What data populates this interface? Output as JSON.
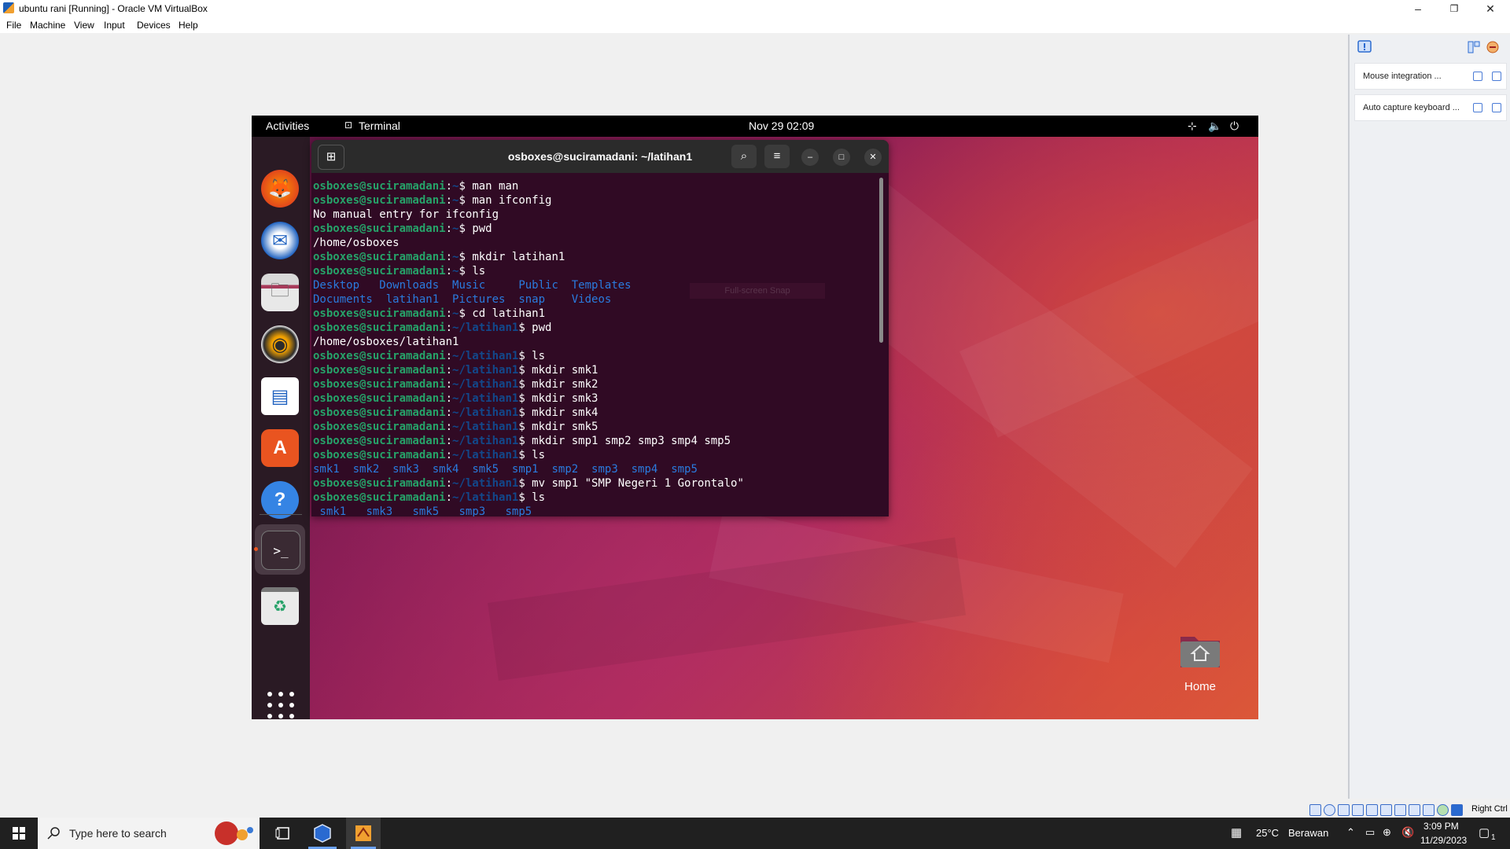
{
  "window": {
    "title": "ubuntu rani [Running] - Oracle VM VirtualBox",
    "controls": {
      "minimize": "–",
      "restore": "❐",
      "close": "✕"
    }
  },
  "menubar": [
    "File",
    "Machine",
    "View",
    "Input",
    "Devices",
    "Help"
  ],
  "vbox_panel": {
    "entries": [
      {
        "label": "Mouse integration ..."
      },
      {
        "label": "Auto capture keyboard ..."
      }
    ]
  },
  "guest": {
    "topbar": {
      "activities": "Activities",
      "app_label": "Terminal",
      "clock": "Nov 29  02:09"
    },
    "dock": {
      "apps": [
        {
          "name": "firefox",
          "glyph": "🦊"
        },
        {
          "name": "thunderbird",
          "glyph": "✉"
        },
        {
          "name": "files",
          "glyph": "🗀"
        },
        {
          "name": "rhythmbox",
          "glyph": "◉"
        },
        {
          "name": "writer",
          "glyph": "▤"
        },
        {
          "name": "software",
          "glyph": "A"
        },
        {
          "name": "help",
          "glyph": "?"
        }
      ],
      "terminal_glyph": ">_",
      "trash_glyph": "♻"
    },
    "terminal": {
      "title": "osboxes@suciramadani: ~/latihan1",
      "new_tab_glyph": "⊞",
      "search_glyph": "⌕",
      "menu_glyph": "≡",
      "minimize_glyph": "–",
      "maximize_glyph": "□",
      "close_glyph": "✕",
      "lines": [
        {
          "user": "osboxes@suciramadani",
          "path": "~",
          "cmd": "man man"
        },
        {
          "user": "osboxes@suciramadani",
          "path": "~",
          "cmd": "man ifconfig"
        },
        {
          "out": "No manual entry for ifconfig"
        },
        {
          "user": "osboxes@suciramadani",
          "path": "~",
          "cmd": "pwd"
        },
        {
          "out": "/home/osboxes"
        },
        {
          "user": "osboxes@suciramadani",
          "path": "~",
          "cmd": "mkdir latihan1"
        },
        {
          "user": "osboxes@suciramadani",
          "path": "~",
          "cmd": "ls"
        },
        {
          "dirs": [
            "Desktop   ",
            "Downloads  ",
            "Music     ",
            "Public  ",
            "Templates"
          ]
        },
        {
          "dirs": [
            "Documents  ",
            "latihan1  ",
            "Pictures  ",
            "snap    ",
            "Videos"
          ]
        },
        {
          "user": "osboxes@suciramadani",
          "path": "~",
          "cmd": "cd latihan1"
        },
        {
          "user": "osboxes@suciramadani",
          "path": "~/latihan1",
          "cmd": "pwd"
        },
        {
          "out": "/home/osboxes/latihan1"
        },
        {
          "user": "osboxes@suciramadani",
          "path": "~/latihan1",
          "cmd": "ls"
        },
        {
          "user": "osboxes@suciramadani",
          "path": "~/latihan1",
          "cmd": "mkdir smk1"
        },
        {
          "user": "osboxes@suciramadani",
          "path": "~/latihan1",
          "cmd": "mkdir smk2"
        },
        {
          "user": "osboxes@suciramadani",
          "path": "~/latihan1",
          "cmd": "mkdir smk3"
        },
        {
          "user": "osboxes@suciramadani",
          "path": "~/latihan1",
          "cmd": "mkdir smk4"
        },
        {
          "user": "osboxes@suciramadani",
          "path": "~/latihan1",
          "cmd": "mkdir smk5"
        },
        {
          "user": "osboxes@suciramadani",
          "path": "~/latihan1",
          "cmd": "mkdir smp1 smp2 smp3 smp4 smp5"
        },
        {
          "user": "osboxes@suciramadani",
          "path": "~/latihan1",
          "cmd": "ls"
        },
        {
          "dirs": [
            "smk1  ",
            "smk2  ",
            "smk3  ",
            "smk4  ",
            "smk5  ",
            "smp1  ",
            "smp2  ",
            "smp3  ",
            "smp4  ",
            "smp5"
          ]
        },
        {
          "user": "osboxes@suciramadani",
          "path": "~/latihan1",
          "cmd": "mv smp1 \"SMP Negeri 1 Gorontalo\""
        },
        {
          "user": "osboxes@suciramadani",
          "path": "~/latihan1",
          "cmd": "ls"
        },
        {
          "dirs": [
            " smk1   ",
            "smk3   ",
            "smk5   ",
            "smp3   ",
            "smp5"
          ]
        }
      ],
      "ghost_label": "Full-screen Snap"
    },
    "desktop": {
      "home_label": "Home"
    }
  },
  "statusbar": {
    "right_ctrl": "Right Ctrl"
  },
  "taskbar": {
    "search_placeholder": "Type here to search",
    "weather_temp": "25°C",
    "weather_desc": "Berawan",
    "time": "3:09 PM",
    "date": "11/29/2023",
    "notification_count": "1"
  },
  "colors": {
    "ubuntu_orange": "#e95420",
    "terminal_bg": "#300a24",
    "prompt_green": "#26a269",
    "prompt_blue": "#12488b"
  }
}
